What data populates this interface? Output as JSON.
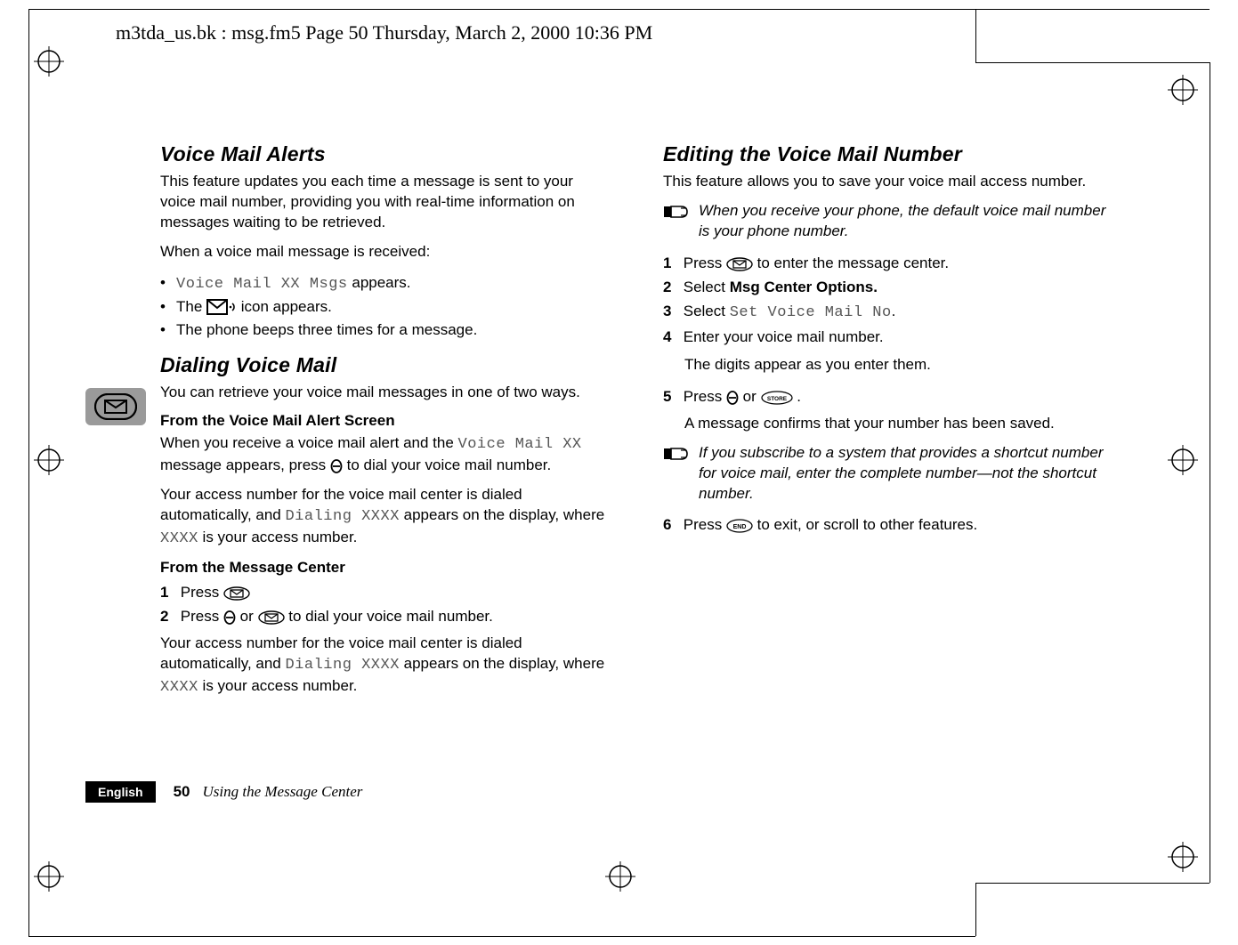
{
  "running_head": "m3tda_us.bk : msg.fm5  Page 50  Thursday, March 2, 2000  10:36 PM",
  "left": {
    "h2a": "Voice Mail Alerts",
    "p1": "This feature updates you each time a message is sent to your voice mail number, providing you with real-time information on messages waiting to be retrieved.",
    "p2": "When a voice mail message is received:",
    "bullets": {
      "b1_lcd": "Voice Mail XX Msgs",
      "b1_tail": " appears.",
      "b2_a": "The ",
      "b2_b": " icon appears.",
      "b3": "The phone beeps three times for a message."
    },
    "h2b": "Dialing Voice Mail",
    "p3": "You can retrieve your voice mail messages in one of two ways.",
    "h3a": "From the Voice Mail Alert Screen",
    "p4_a": "When you receive a voice mail alert and the ",
    "p4_lcd": "Voice Mail XX",
    "p4_b": " message appears, press ",
    "p4_c": " to dial your voice mail number.",
    "p5_a": "Your access number for the voice mail center is dialed automatically, and ",
    "p5_lcd": "Dialing XXXX",
    "p5_b": " appears on the display, where ",
    "p5_lcd2": "XXXX",
    "p5_c": " is your access number.",
    "h3b": "From the Message Center",
    "ol": {
      "n1": "1",
      "l1_a": "Press ",
      "n2": "2",
      "l2_a": "Press ",
      "l2_b": " or ",
      "l2_c": " to dial your voice mail number."
    },
    "p6_a": "Your access number for the voice mail center is dialed automatically, and ",
    "p6_lcd": "Dialing XXXX",
    "p6_b": " appears on the display, where ",
    "p6_lcd2": "XXXX",
    "p6_c": " is your access number."
  },
  "right": {
    "h2": "Editing the Voice Mail Number",
    "p1": "This feature allows you to save your voice mail access number.",
    "note1": "When you receive your phone, the default voice mail number is your phone number.",
    "ol": {
      "n1": "1",
      "l1_a": "Press ",
      "l1_b": " to enter the message center.",
      "n2": "2",
      "l2_a": "Select ",
      "l2_bold": "Msg Center Options.",
      "n3": "3",
      "l3_a": "Select ",
      "l3_lcd": "Set Voice Mail No",
      "l3_dot": ".",
      "n4": "4",
      "l4": "Enter your voice mail number.",
      "l4_sub": "The digits appear as you enter them.",
      "n5": "5",
      "l5_a": "Press ",
      "l5_b": " or ",
      "l5_c": ".",
      "l5_sub": "A message confirms that your number has been saved.",
      "n6": "6",
      "l6_a": "Press ",
      "l6_b": " to exit, or scroll to other features."
    },
    "note2": "If you subscribe to a system that provides a shortcut number for voice mail, enter the complete number—not the shortcut number."
  },
  "footer": {
    "lang": "English",
    "page": "50",
    "section": "Using the Message Center"
  },
  "icons": {
    "envelope_sound": "envelope-sound-icon",
    "theta_key": "theta-key-icon",
    "envelope_key": "envelope-key-icon",
    "store_key": "store-key-icon",
    "end_key": "end-key-icon",
    "note_hand": "note-hand-icon"
  }
}
